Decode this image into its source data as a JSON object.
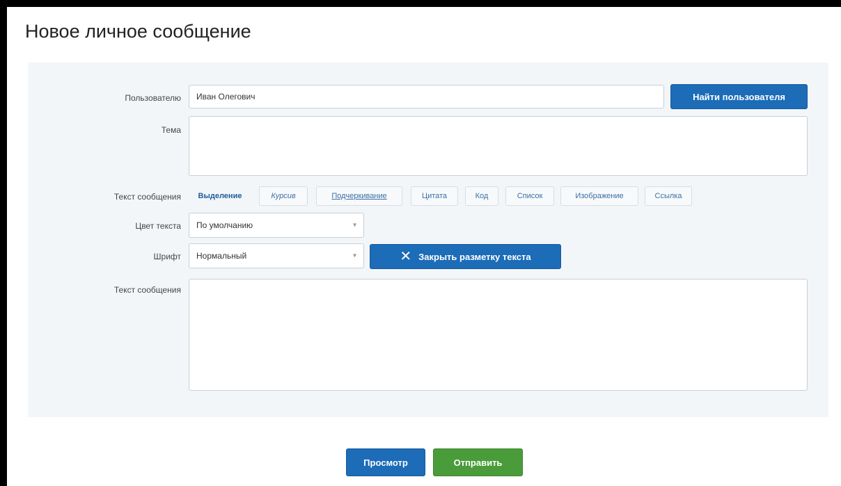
{
  "title": "Новое личное сообщение",
  "form": {
    "users_label": "Пользователю",
    "users_value": "Иван Олегович",
    "find_user_button": "Найти пользователя",
    "subject_label": "Тема",
    "subject_value": "",
    "format_label": "Текст сообщения",
    "format_buttons": [
      "Выделение",
      "Курсив",
      "Подчеркивание",
      "Цитата",
      "Код",
      "Список",
      "Изображение",
      "Ссылка"
    ],
    "color_label": "Цвет текста",
    "color_value": "По умолчанию",
    "font_label": "Шрифт",
    "font_value": "Нормальный",
    "close_markup_button": "Закрыть разметку текста",
    "message_label": "Текст сообщения",
    "message_value": ""
  },
  "actions": {
    "preview": "Просмотр",
    "send": "Отправить"
  },
  "colors": {
    "primary": "#1c6cb8",
    "success": "#4a9c3a",
    "panel": "#f3f6f9"
  }
}
